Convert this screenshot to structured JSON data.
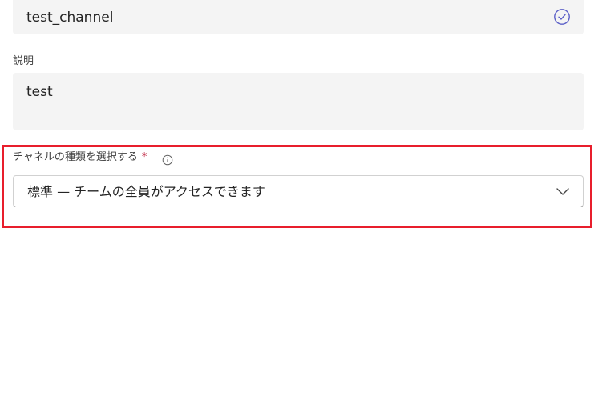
{
  "channel_name": {
    "value": "test_channel",
    "valid_icon": "checkmark-circle-icon",
    "accent_color": "#5b5fc7"
  },
  "description": {
    "label": "説明",
    "value": "test"
  },
  "channel_type": {
    "label": "チャネルの種類を選択する",
    "required_marker": "*",
    "info_icon": "info-icon",
    "selected_option": "標準 — チームの全員がアクセスできます",
    "dropdown_icon": "chevron-down-icon"
  },
  "colors": {
    "field_background": "#f4f4f4",
    "highlight_border": "#e81e2c",
    "required_marker": "#c4314b"
  }
}
